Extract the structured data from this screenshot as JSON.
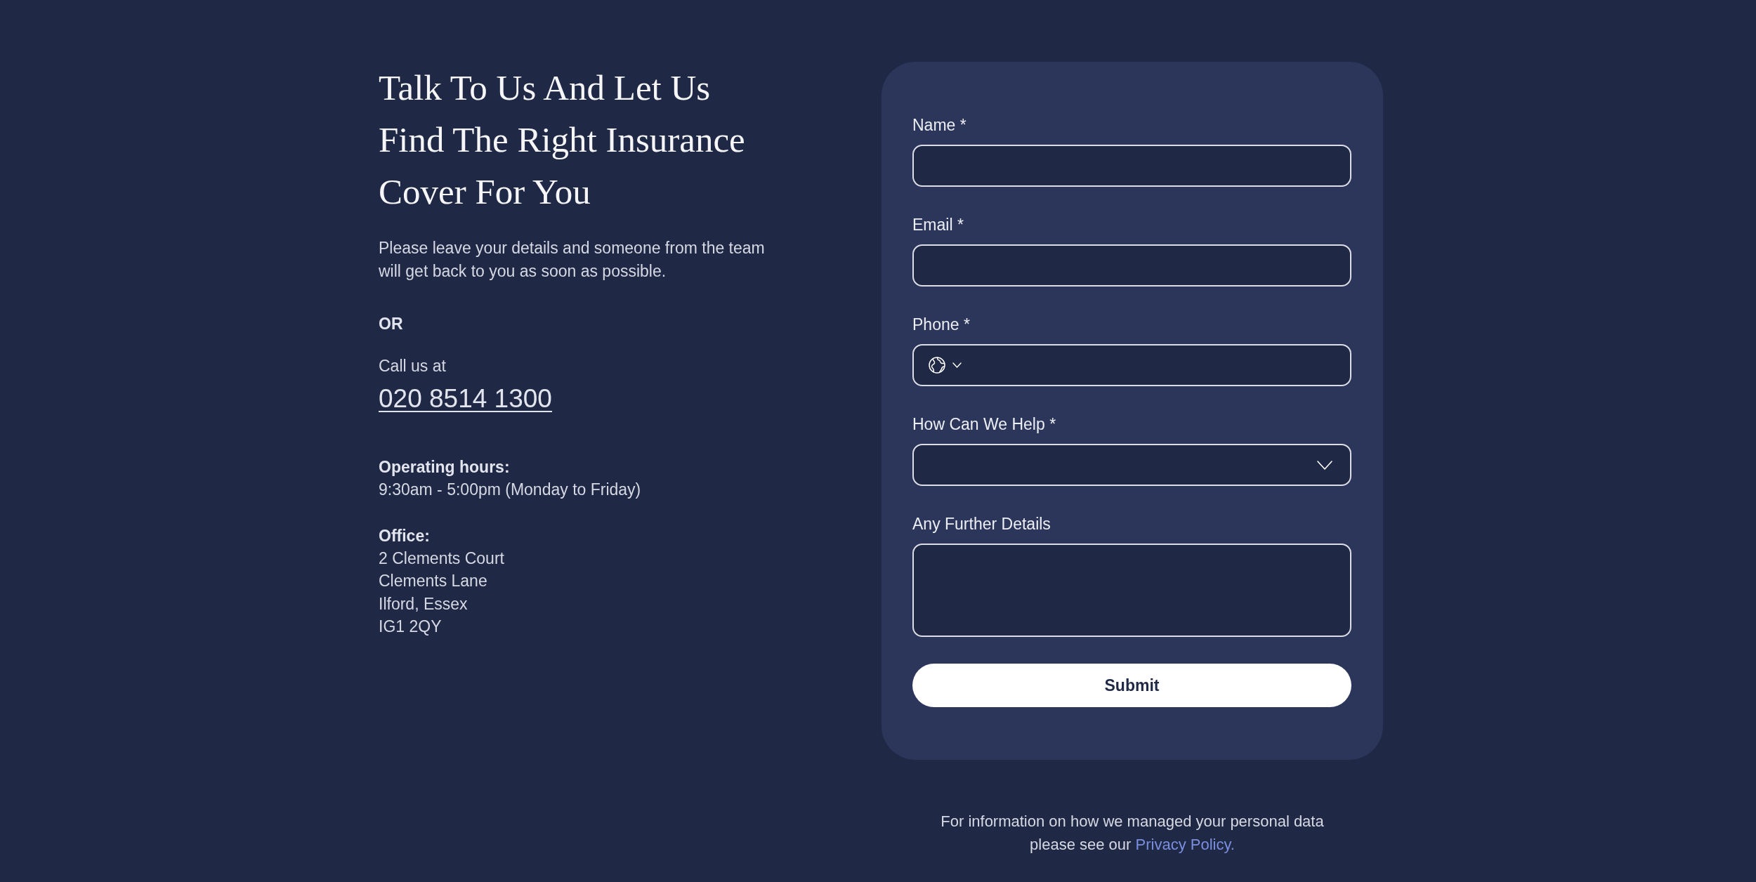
{
  "intro": {
    "heading": "Talk To Us And Let Us Find The Right Insurance Cover For You",
    "text": "Please leave your details and someone from the team will get back to you as soon as possible."
  },
  "alternative": {
    "separator": "OR",
    "call_label": "Call us at",
    "phone": "020 8514 1300"
  },
  "info_blocks": [
    {
      "title": "Operating hours:",
      "lines": [
        "9:30am - 5:00pm (Monday to Friday)"
      ]
    },
    {
      "title": "Office:",
      "lines": [
        "2 Clements Court",
        "Clements Lane",
        "Ilford, Essex",
        "IG1 2QY"
      ]
    }
  ],
  "form": {
    "fields": [
      {
        "kind": "text",
        "label": "Name *"
      },
      {
        "kind": "text",
        "label": "Email *"
      },
      {
        "kind": "phone",
        "label": "Phone *"
      },
      {
        "kind": "select",
        "label": "How Can We Help *"
      },
      {
        "kind": "textarea",
        "label": "Any Further Details"
      }
    ],
    "submit": "Submit"
  },
  "privacy_note": {
    "text": "For information on how we managed your personal data please see our",
    "link": "Privacy Policy."
  }
}
